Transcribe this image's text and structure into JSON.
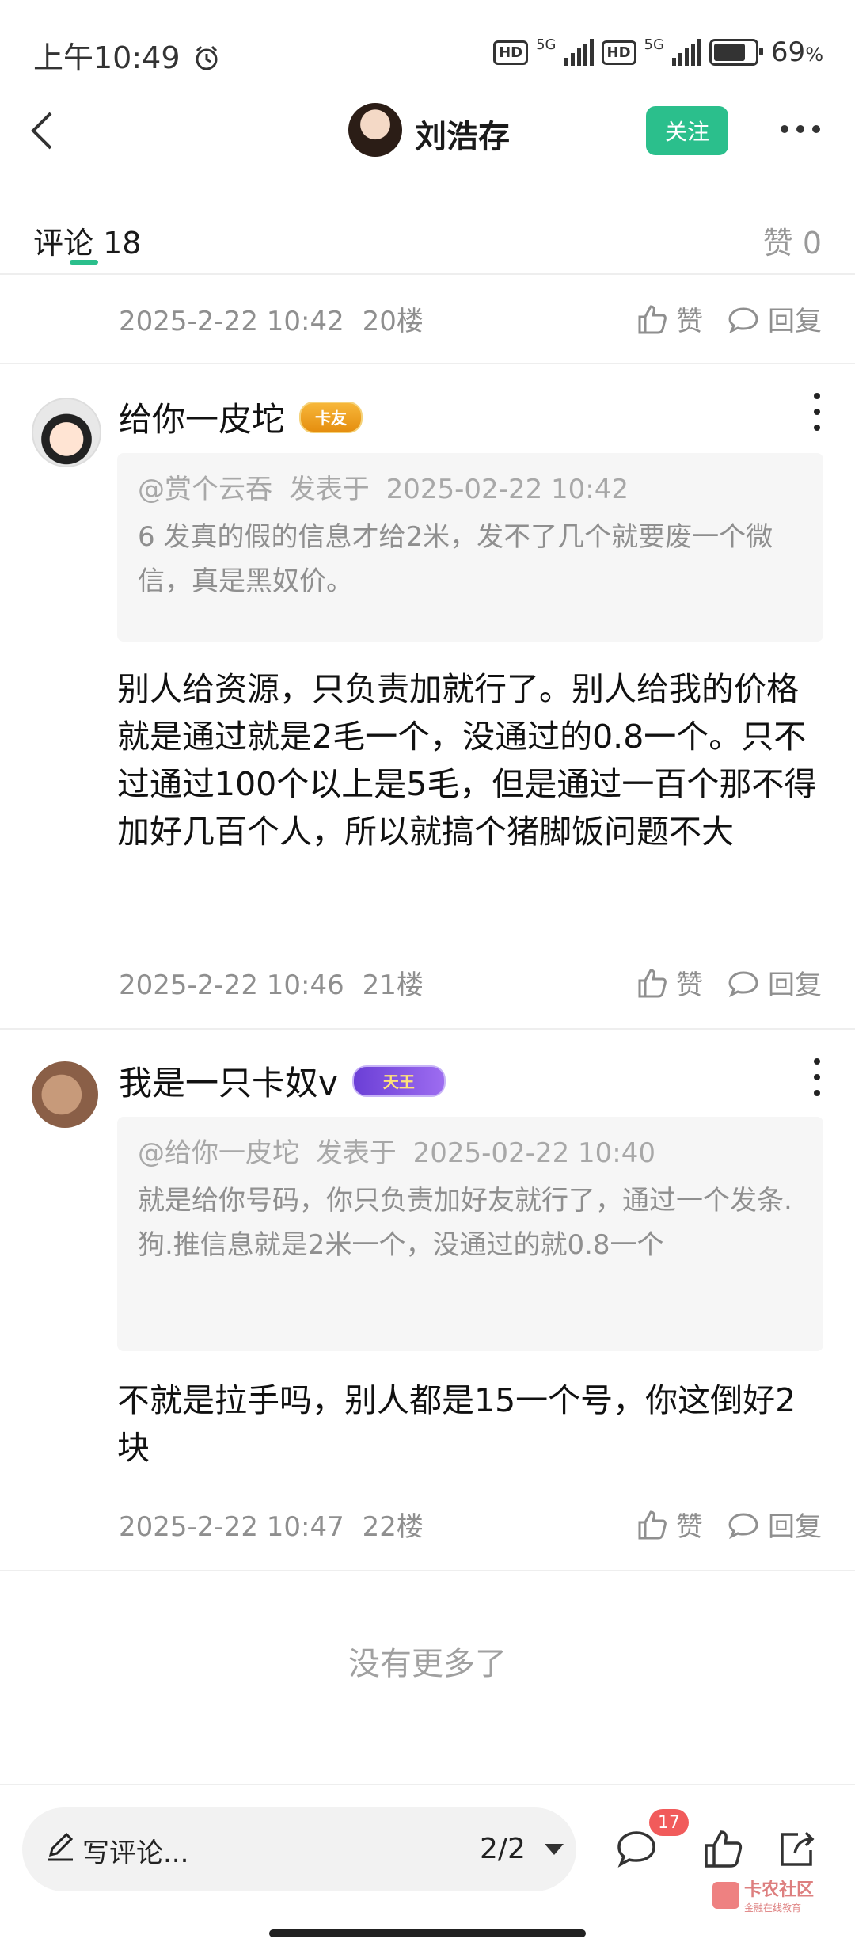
{
  "status_bar": {
    "time": "上午10:49",
    "network_left": "5G",
    "network_right": "5G",
    "hd": "HD",
    "battery_pct": "69",
    "battery_suffix": "%"
  },
  "header": {
    "title": "刘浩存",
    "follow_label": "关注"
  },
  "tabs": {
    "comments_label": "评论",
    "comments_count": "18",
    "likes_label": "赞",
    "likes_count": "0"
  },
  "action_labels": {
    "like": "赞",
    "reply": "回复"
  },
  "top_item": {
    "timestamp": "2025-2-22 10:42",
    "floor": "20楼"
  },
  "comments": [
    {
      "username": "给你一皮坨",
      "badge": "卡友",
      "quote_author": "@赏个云吞",
      "quote_posted": "发表于",
      "quote_time": "2025-02-22 10:42",
      "quote_body": "6 发真的假的信息才给2米，发不了几个就要废一个微信，真是黑奴价。",
      "content": "别人给资源，只负责加就行了。别人给我的价格就是通过就是2毛一个，没通过的0.8一个。只不过通过100个以上是5毛，但是通过一百个那不得加好几百个人，所以就搞个猪脚饭问题不大",
      "timestamp": "2025-2-22 10:46",
      "floor": "21楼"
    },
    {
      "username": "我是一只卡奴v",
      "badge": "天王",
      "quote_author": "@给你一皮坨",
      "quote_posted": "发表于",
      "quote_time": "2025-02-22 10:40",
      "quote_body": "就是给你号码，你只负责加好友就行了，通过一个发条.狗.推信息就是2米一个，没通过的就0.8一个",
      "content": "不就是拉手吗，别人都是15一个号，你这倒好2块",
      "timestamp": "2025-2-22 10:47",
      "floor": "22楼"
    }
  ],
  "no_more": "没有更多了",
  "bottom_bar": {
    "comment_placeholder": "写评论...",
    "page": "2/2",
    "message_count": "17"
  },
  "watermark": {
    "title": "卡农社区",
    "subtitle": "金融在线教育"
  },
  "colors": {
    "accent": "#2bbf8c",
    "badge_red": "#f15b5b"
  },
  "icons": [
    "back-arrow-icon",
    "more-icon",
    "thumb-up-icon",
    "reply-bubble-icon",
    "menu-dots-icon",
    "pen-icon",
    "chat-icon",
    "share-icon",
    "alarm-icon"
  ]
}
